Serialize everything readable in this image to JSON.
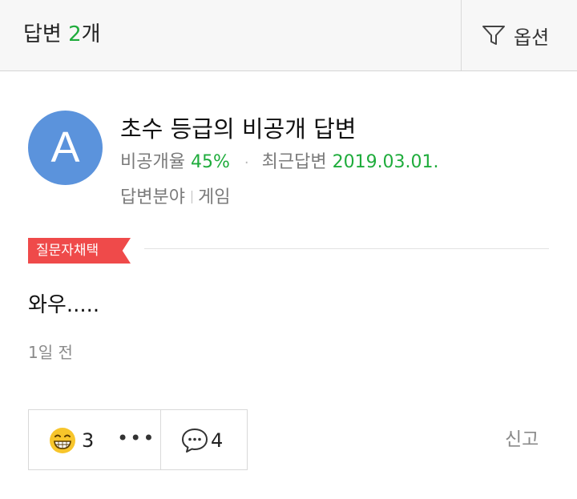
{
  "header": {
    "answers_prefix": "답변 ",
    "answers_count": "2",
    "answers_suffix": "개",
    "options_label": "옵션"
  },
  "answer": {
    "avatar_letter": "A",
    "author": "초수 등급의 비공개 답변",
    "private_rate_label": "비공개율",
    "private_rate_value": "45%",
    "recent_label": "최근답변",
    "recent_date": "2019.03.01.",
    "field_label": "답변분야",
    "field_value": "게임",
    "badge": "질문자채택",
    "body": "와우.....",
    "time": "1일 전",
    "likes": "3",
    "more": "•••",
    "comments": "4",
    "report": "신고"
  },
  "icons": [
    "filter-icon",
    "grin-emoji-icon",
    "comment-bubble-icon",
    "more-icon"
  ],
  "colors": {
    "accent_green": "#1fac3c",
    "avatar_blue": "#5b93dc",
    "badge_red": "#ef4a4a"
  }
}
